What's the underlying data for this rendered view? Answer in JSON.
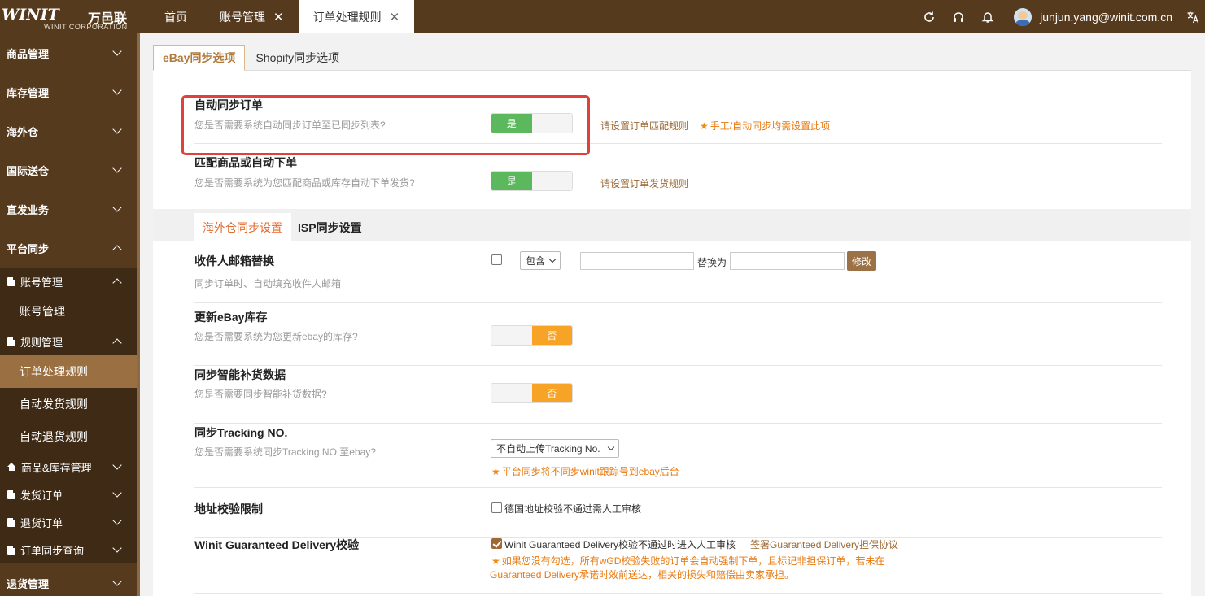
{
  "brand": {
    "logo_text": "WINIT",
    "logo_cn": "万邑联",
    "logo_sub": "WINIT CORPORATION"
  },
  "top_tabs": [
    {
      "label": "首页",
      "closable": false
    },
    {
      "label": "账号管理",
      "closable": true
    },
    {
      "label": "订单处理规则",
      "closable": true,
      "active": true
    }
  ],
  "top_icons": [
    "refresh-icon",
    "headset-icon",
    "bell-icon"
  ],
  "user": {
    "email": "junjun.yang@winit.com.cn"
  },
  "lang_icon": "translate-icon",
  "sidebar": {
    "groups": [
      {
        "label": "商品管理"
      },
      {
        "label": "库存管理"
      },
      {
        "label": "海外仓"
      },
      {
        "label": "国际送仓"
      },
      {
        "label": "直发业务"
      },
      {
        "label": "平台同步"
      }
    ],
    "sub": {
      "account_mgmt": "账号管理",
      "account_mgmt_leaf": "账号管理",
      "rule_mgmt": "规则管理",
      "leaf_order_rule": "订单处理规则",
      "leaf_ship_rule": "自动发货规则",
      "leaf_return_rule": "自动退货规则",
      "goods_stock": "商品&库存管理",
      "ship_order": "发货订单",
      "return_order": "退货订单",
      "sync_query": "订单同步查询"
    },
    "bottom_group": "退货管理"
  },
  "panel_tabs": {
    "ebay": "eBay同步选项",
    "shopify": "Shopify同步选项"
  },
  "settings": {
    "auto_sync": {
      "title": "自动同步订单",
      "desc": "您是否需要系统自动同步订单至已同步列表?",
      "toggle": "是",
      "link": "请设置订单匹配规则",
      "note": "手工/自动同步均需设置此项"
    },
    "match_goods": {
      "title": "匹配商品或自动下单",
      "desc": "您是否需要系统为您匹配商品或库存自动下单发货?",
      "toggle": "是",
      "link": "请设置订单发货规则"
    }
  },
  "sub_tabs": {
    "overseas": "海外仓同步设置",
    "isp": "ISP同步设置"
  },
  "overseas": {
    "email_replace": {
      "title": "收件人邮箱替换",
      "desc": "同步订单时、自动填充收件人邮箱",
      "select": "包含",
      "replace_label": "替换为",
      "button": "修改"
    },
    "update_stock": {
      "title": "更新eBay库存",
      "desc": "您是否需要系统为您更新ebay的库存?",
      "toggle": "否"
    },
    "smart_restock": {
      "title": "同步智能补货数据",
      "desc": "您是否需要同步智能补货数据?",
      "toggle": "否"
    },
    "tracking": {
      "title": "同步Tracking NO.",
      "desc": "您是否需要系统同步Tracking NO.至ebay?",
      "select": "不自动上传Tracking No.",
      "note": "平台同步将不同步winit跟踪号到ebay后台"
    },
    "address": {
      "title": "地址校验限制",
      "checkbox": "德国地址校验不通过需人工审核"
    },
    "guaranteed": {
      "title": "Winit Guaranteed Delivery校验",
      "checkbox": "Winit Guaranteed Delivery校验不通过时进入人工审核",
      "link": "签署Guaranteed Delivery担保协议",
      "note_line1": "如果您没有勾选，所有wGD校验失败的订单会自动强制下单，且标记非担保订单，若未在",
      "note_line2": "Guaranteed Delivery承诺时效前送达，相关的损失和赔偿由卖家承担。"
    }
  },
  "colors": {
    "brand_brown": "#553a1e",
    "accent_brown": "#9b6a36",
    "green": "#5cb85c",
    "orange": "#f7a326",
    "highlight_red": "#e0413c"
  }
}
